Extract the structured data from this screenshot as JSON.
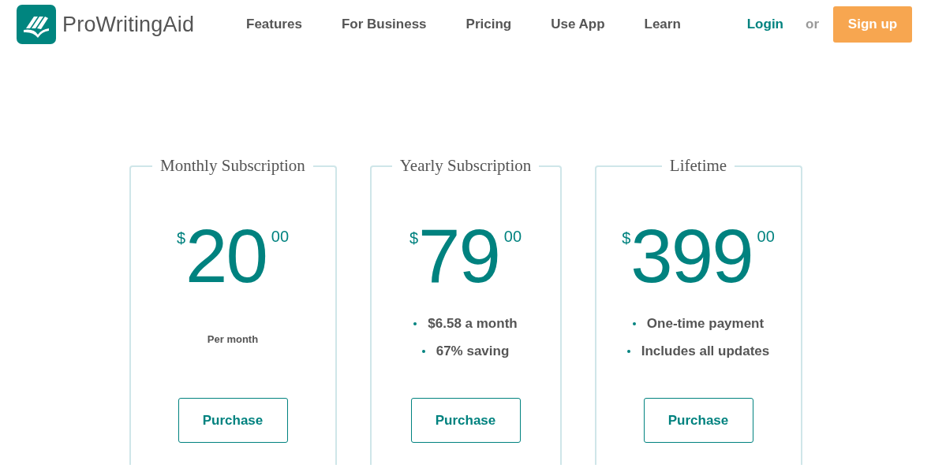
{
  "header": {
    "brand": "ProWritingAid",
    "nav": [
      "Features",
      "For Business",
      "Pricing",
      "Use App",
      "Learn"
    ],
    "login": "Login",
    "or": "or",
    "signup": "Sign up"
  },
  "plans": [
    {
      "title": "Monthly Subscription",
      "currency": "$",
      "amount": "20",
      "cents": "00",
      "note": "Per month",
      "button": "Purchase"
    },
    {
      "title": "Yearly Subscription",
      "currency": "$",
      "amount": "79",
      "cents": "00",
      "perks": [
        "$6.58 a month",
        "67% saving"
      ],
      "button": "Purchase"
    },
    {
      "title": "Lifetime",
      "currency": "$",
      "amount": "399",
      "cents": "00",
      "perks": [
        "One-time payment",
        "Includes all updates"
      ],
      "button": "Purchase"
    }
  ]
}
